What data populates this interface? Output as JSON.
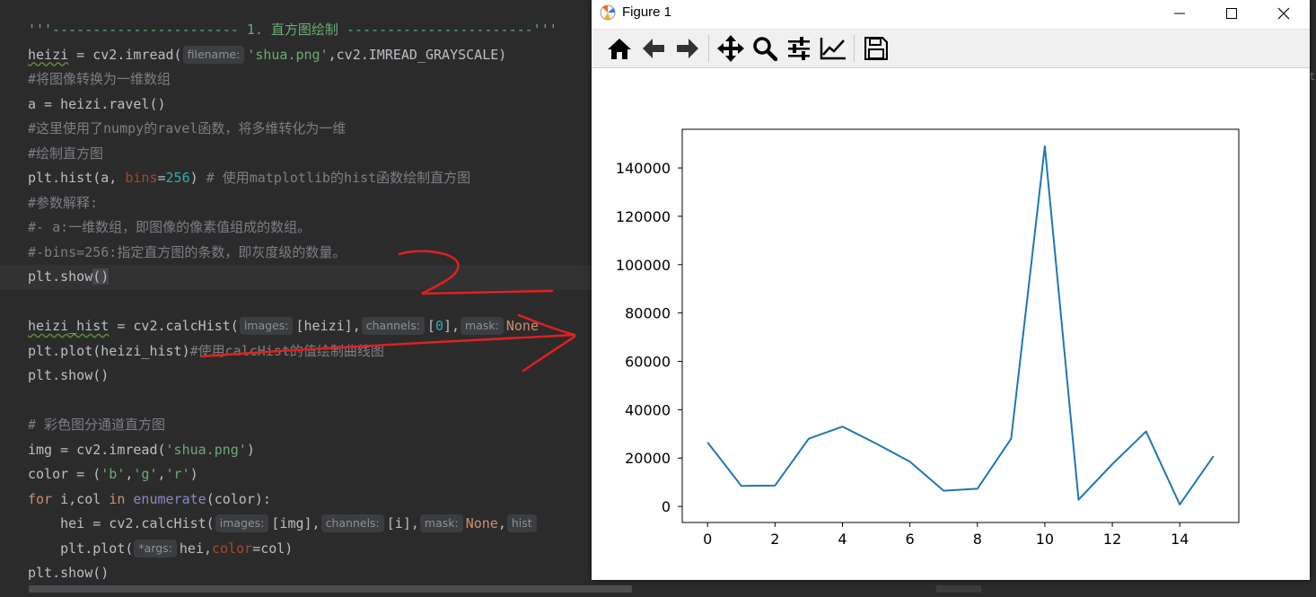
{
  "editor": {
    "line1_prefix": "'''----------------------- ",
    "line1_title": "1. 直方图绘制",
    "line1_suffix": " -----------------------'''",
    "l2_var": "heizi",
    "l2_a": " = cv2.imread(",
    "l2_hint": "filename:",
    "l2_str": "'shua.png'",
    "l2_b": ",cv2.IMREAD_GRAYSCALE)",
    "l3": "#将图像转换为一维数组",
    "l4": "a = heizi.ravel()",
    "l5": "#这里使用了numpy的ravel函数，将多维转化为一维",
    "l6": "#绘制直方图",
    "l7_a": "plt.hist(a, ",
    "l7_kw": "bins",
    "l7_eq": "=",
    "l7_num": "256",
    "l7_b": ") ",
    "l7_cmt": "# 使用matplotlib的hist函数绘制直方图",
    "l8": "#参数解释:",
    "l9": "#- a:一维数组，即图像的像素值组成的数组。",
    "l10": "#-bins=256:指定直方图的条数，即灰度级的数量。",
    "l11_a": "plt.show",
    "l11_b": "()",
    "l13_var": "heizi_hist",
    "l13_a": " = cv2.calcHist(",
    "l13_hint1": "images:",
    "l13_b": "[heizi],",
    "l13_hint2": "channels:",
    "l13_c": "[",
    "l13_num": "0",
    "l13_d": "],",
    "l13_hint3": "mask:",
    "l13_none": "None",
    "l14_a": "plt.plot(heizi_hist)",
    "l14_cmt": "#使用calcHist的值绘制曲线图",
    "l15": "plt.show()",
    "l17": "# 彩色图分通道直方图",
    "l18_a": "img = cv2.imread(",
    "l18_str": "'shua.png'",
    "l18_b": ")",
    "l19_a": "color = (",
    "l19_s1": "'b'",
    "l19_c1": ",",
    "l19_s2": "'g'",
    "l19_c2": ",",
    "l19_s3": "'r'",
    "l19_b": ")",
    "l20_for": "for",
    "l20_a": " i,col ",
    "l20_in": "in",
    "l20_sp": " ",
    "l20_enum": "enumerate",
    "l20_b": "(color):",
    "l21_a": "    hei = cv2.calcHist(",
    "l21_hint1": "images:",
    "l21_b": "[img],",
    "l21_hint2": "channels:",
    "l21_c": "[i],",
    "l21_hint3": "mask:",
    "l21_none": "None",
    "l21_d": ",",
    "l21_hint4": "hist",
    "l22_a": "    plt.plot(",
    "l22_hint": "*args:",
    "l22_b": "hei,",
    "l22_kw": "color",
    "l22_c": "=col)",
    "l23": "plt.show()",
    "right_edge": "t"
  },
  "figure": {
    "title": "Figure 1",
    "toolbar": [
      "home",
      "back",
      "forward",
      "pan",
      "zoom",
      "configure-subplots",
      "edit-axis",
      "save"
    ]
  },
  "colors": {
    "editor_bg": "#2b2b2b",
    "line_color": "#1f77b4",
    "annotation": "#e02020"
  },
  "chart_data": {
    "type": "line",
    "x": [
      0,
      1,
      2,
      3,
      4,
      5,
      6,
      7,
      8,
      9,
      10,
      11,
      12,
      13,
      14,
      15
    ],
    "series": [
      {
        "values": [
          26500,
          8500,
          8600,
          28000,
          33000,
          26000,
          18500,
          6500,
          7300,
          28000,
          149000,
          2800,
          17500,
          31000,
          800,
          20800
        ]
      }
    ],
    "xticks": [
      "0",
      "2",
      "4",
      "6",
      "8",
      "10",
      "12",
      "14"
    ],
    "yticks": [
      "0",
      "20000",
      "40000",
      "60000",
      "80000",
      "100000",
      "120000",
      "140000"
    ],
    "xlim": [
      -0.75,
      15.75
    ],
    "ylim": [
      -6650,
      156000
    ],
    "grid": false,
    "title": "",
    "xlabel": "",
    "ylabel": ""
  }
}
